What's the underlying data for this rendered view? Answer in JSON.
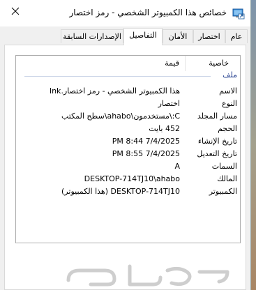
{
  "window": {
    "title": "خصائص هذا الكمبيوتر الشخصي - رمز اختصار",
    "tabs": [
      {
        "label": "عام",
        "active": false
      },
      {
        "label": "اختصار",
        "active": false
      },
      {
        "label": "الأمان",
        "active": false
      },
      {
        "label": "التفاصيل",
        "active": true
      },
      {
        "label": "الإصدارات السابقة",
        "active": false
      }
    ]
  },
  "details": {
    "columns": {
      "property": "خاصية",
      "value": "قيمة"
    },
    "group": "ملف",
    "rows": [
      {
        "key": "الاسم",
        "value": "هذا الكمبيوتر الشخصي - رمز اختصار.lnk"
      },
      {
        "key": "النوع",
        "value": "اختصار"
      },
      {
        "key": "مسار المجلد",
        "value": "C:\\مستخدمون\\ahabo\\سطح المكتب"
      },
      {
        "key": "الحجم",
        "value": "452 بايت"
      },
      {
        "key": "تاريخ الإنشاء",
        "value": "7/4/2025 8:44 PM"
      },
      {
        "key": "تاريخ التعديل",
        "value": "7/4/2025 8:55 PM"
      },
      {
        "key": "السمات",
        "value": "A"
      },
      {
        "key": "المالك",
        "value": "DESKTOP-714TJ10\\ahabo"
      },
      {
        "key": "الكمبيوتر",
        "value": "DESKTOP-714TJ10 (هذا الكمبيوتر)"
      }
    ]
  },
  "watermark": {
    "text": "حراج"
  },
  "icons": {
    "app": "shortcut-icon",
    "close": "close-icon"
  },
  "colors": {
    "group_label": "#1e3a8c",
    "window_bg": "#f0f0f0",
    "desktop": "#8fa3b6"
  }
}
